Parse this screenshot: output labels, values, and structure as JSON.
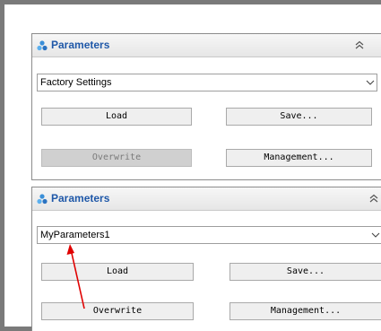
{
  "panel_top": {
    "title": "Parameters",
    "preset_selected": "Factory Settings",
    "load_label": "Load",
    "save_label": "Save...",
    "overwrite_label": "Overwrite",
    "management_label": "Management...",
    "overwrite_disabled": true
  },
  "panel_bottom": {
    "title": "Parameters",
    "preset_selected": "MyParameters1",
    "load_label": "Load",
    "save_label": "Save...",
    "overwrite_label": "Overwrite",
    "management_label": "Management...",
    "overwrite_disabled": false
  },
  "colors": {
    "title": "#1f58a8",
    "annotation_arrow": "#e00000"
  },
  "icons": {
    "header": "parameters-icon",
    "collapse": "collapse-chevrons-icon",
    "dropdown": "chevron-down-icon"
  }
}
